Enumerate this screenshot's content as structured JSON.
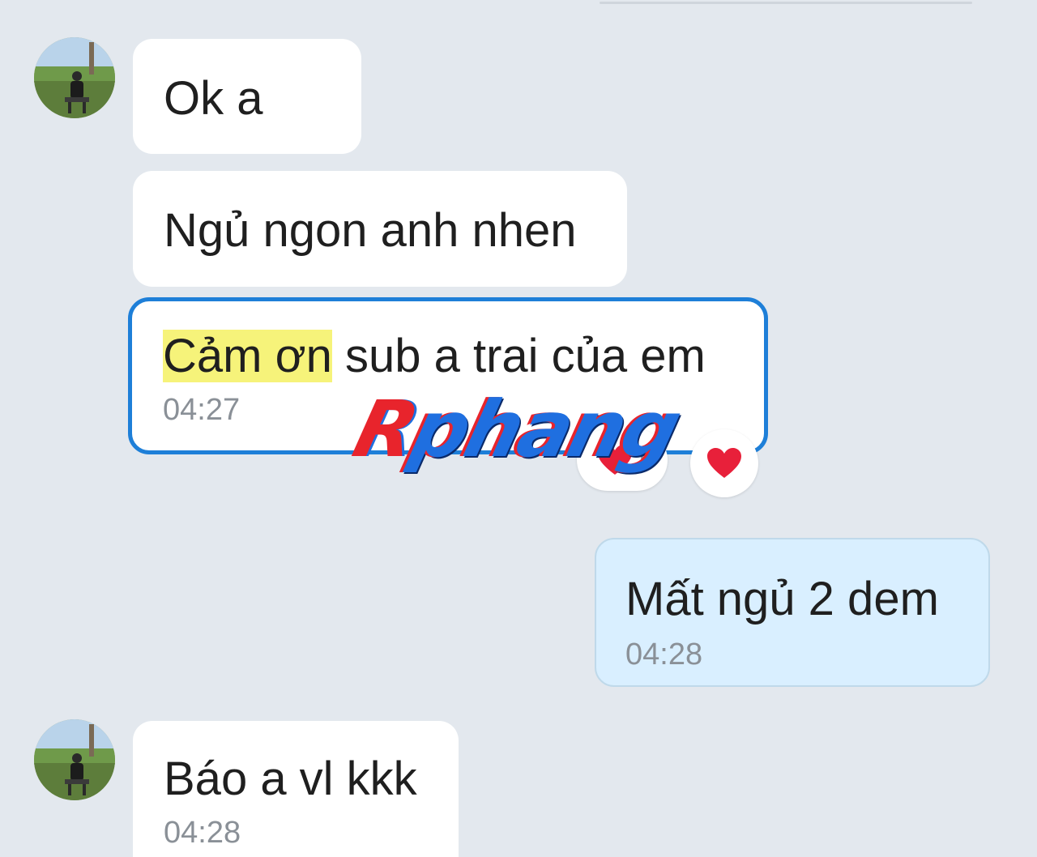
{
  "conversation": {
    "messages": [
      {
        "text": "Ok a",
        "time": ""
      },
      {
        "text": "Ngủ ngon anh nhen",
        "time": ""
      },
      {
        "highlight": "Cảm ơn",
        "rest": " sub a trai của em",
        "time": "04:27",
        "reactions": {
          "count": "1"
        }
      },
      {
        "text": "Mất ngủ 2 dem",
        "time": "04:28"
      },
      {
        "text": "Báo a vl kkk",
        "time": "04:28"
      }
    ]
  },
  "watermark": {
    "first": "R",
    "rest": "phang"
  },
  "icons": {
    "avatar": "contact-avatar-photo",
    "heart": "heart-icon"
  },
  "colors": {
    "background": "#e3e8ee",
    "incoming_bubble": "#ffffff",
    "outgoing_bubble": "#d9efff",
    "selected_border": "#1e7fd8",
    "highlight": "#f6f37a",
    "heart": "#e8203a"
  }
}
